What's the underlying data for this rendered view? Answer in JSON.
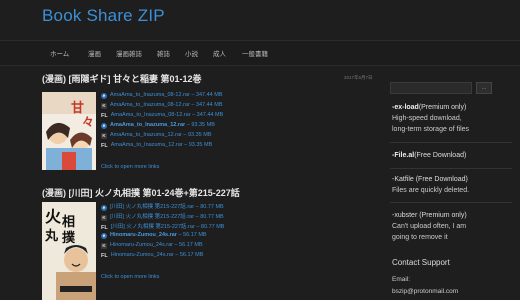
{
  "site": {
    "title": "Book Share ZIP"
  },
  "nav": [
    "ホーム",
    "漫画",
    "漫画雑誌",
    "雑誌",
    "小説",
    "成人",
    "一般書籍"
  ],
  "posts": [
    {
      "title": "(漫画) [雨隠ギド] 甘々と稲妻 第01-12巻",
      "date": "2017年6月7日",
      "links": [
        {
          "host": "ex",
          "name": "AmaAma_to_Inazuma_08-12.rar",
          "size": "347.44 MB",
          "bold": false
        },
        {
          "host": "k",
          "name": "AmaAma_to_Inazuma_08-12.rar",
          "size": "347.44 MB",
          "bold": false
        },
        {
          "host": "fl",
          "name": "AmaAma_to_Inazuma_08-12.rar",
          "size": "347.44 MB",
          "bold": false
        },
        {
          "host": "ex",
          "name": "AmaAma_to_Inazuma_12.rar",
          "size": "93.35 MB",
          "bold": true
        },
        {
          "host": "k",
          "name": "AmaAma_to_Inazuma_12.rar",
          "size": "93.35 MB",
          "bold": false
        },
        {
          "host": "fl",
          "name": "AmaAma_to_Inazuma_12.rar",
          "size": "93.35 MB",
          "bold": false
        }
      ],
      "more": "Click to open more links"
    },
    {
      "title": "(漫画) [川田] 火ノ丸相撲 第01-24巻+第215-227話",
      "date": "",
      "links": [
        {
          "host": "ex",
          "name": "[川田] 火ノ丸相撲 第215-227話.rar",
          "size": "80.77 MB",
          "bold": false
        },
        {
          "host": "k",
          "name": "[川田] 火ノ丸相撲 第215-227話.rar",
          "size": "80.77 MB",
          "bold": false
        },
        {
          "host": "fl",
          "name": "[川田] 火ノ丸相撲 第215-227話.rar",
          "size": "80.77 MB",
          "bold": false
        },
        {
          "host": "ex",
          "name": "Hinomaru-Zumou_24s.rar",
          "size": "56.17 MB",
          "bold": true
        },
        {
          "host": "k",
          "name": "Hinomaru-Zumou_24s.rar",
          "size": "56.17 MB",
          "bold": false
        },
        {
          "host": "fl",
          "name": "Hinomaru-Zumou_24s.rar",
          "size": "56.17 MB",
          "bold": false
        }
      ],
      "more": "Click to open more links"
    }
  ],
  "host_labels": {
    "ex": "e",
    "k": "K",
    "fl": "FL"
  },
  "sidebar": {
    "search_button": "...",
    "services": [
      {
        "name": "-ex-load",
        "tag": "(Premium only)",
        "lines": [
          "High-speed download,",
          "long-term storage of files"
        ]
      },
      {
        "name": "-File.al",
        "tag": "(Free Download)",
        "lines": []
      },
      {
        "name": "-Katfile (Free Download)",
        "tag": "",
        "lines": [
          "Files are quickly deleted."
        ]
      },
      {
        "name": "-xubster (Premium only)",
        "tag": "",
        "lines": [
          "Can't upload often, I am",
          "going to remove it"
        ]
      }
    ],
    "contact_title": "Contact Support",
    "contact_label": "Email:",
    "contact_email": "bszip@protonmail.com"
  },
  "colors": {
    "accent": "#3d8fd6",
    "background": "#1e1e1e",
    "text": "#cccccc"
  }
}
